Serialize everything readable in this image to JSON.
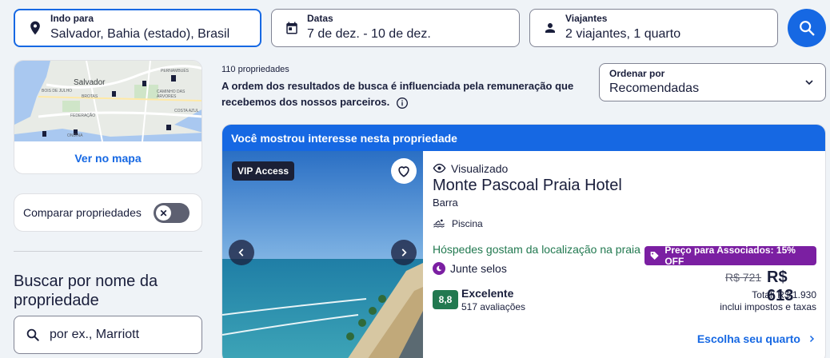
{
  "search": {
    "destination": {
      "label": "Indo para",
      "value": "Salvador, Bahia (estado), Brasil",
      "icon": "location-pin-icon"
    },
    "dates": {
      "label": "Datas",
      "value": "7 de dez. - 10 de dez.",
      "icon": "calendar-icon"
    },
    "travelers": {
      "label": "Viajantes",
      "value": "2 viajantes, 1 quarto",
      "icon": "person-icon"
    },
    "button_icon": "search-icon"
  },
  "sidebar": {
    "map_labels": [
      "Salvador",
      "BOIS DE JULHO",
      "BROTAS",
      "PERNAMBUÉS",
      "CAMINHO DAS ÁRVORES",
      "COSTA AZUL",
      "FEDERAÇÃO",
      "ONDINA"
    ],
    "map_link": "Ver no mapa",
    "compare_label": "Comparar propriedades",
    "name_search_heading": "Buscar por nome da propriedade",
    "name_search_placeholder": "por ex., Marriott"
  },
  "results": {
    "count": "110 propriedades",
    "disclaimer": "A ordem dos resultados de busca é influenciada pela remuneração que recebemos dos nossos parceiros.",
    "sort_label": "Ordenar por",
    "sort_value": "Recomendadas"
  },
  "listing": {
    "banner": "Você mostrou interesse nesta propriedade",
    "vip_badge": "VIP Access",
    "viewed": "Visualizado",
    "name": "Monte Pascoal Praia Hotel",
    "area": "Barra",
    "amenity": "Piscina",
    "location_note": "Hóspedes gostam da localização na praia",
    "promo": "Preço para Associados: 15% OFF",
    "stamps": "Junte selos",
    "price_old": "R$ 721",
    "price_now": "R$ 613",
    "rating": "8,8",
    "rating_word": "Excelente",
    "reviews": "517 avaliações",
    "total": "Total: R$ 1.930",
    "taxes": "inclui impostos e taxas",
    "choose": "Escolha seu quarto"
  },
  "colors": {
    "primary": "#1668e3",
    "promo": "#7b1fa2",
    "rating": "#227950",
    "text": "#191e3b"
  }
}
